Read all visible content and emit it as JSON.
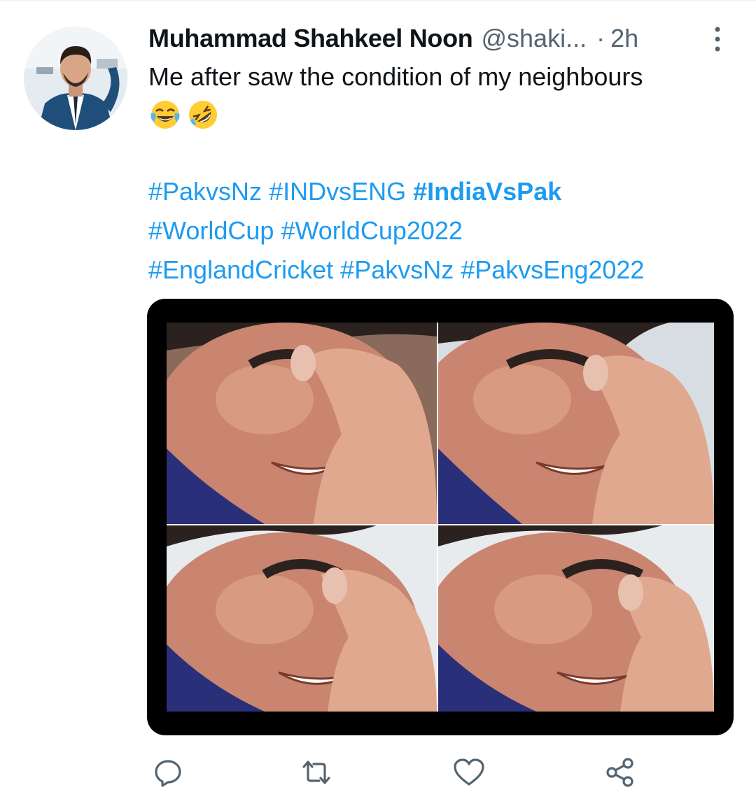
{
  "tweet": {
    "display_name": "Muhammad Shahkeel Noon",
    "handle": "@shaki...",
    "separator": "·",
    "timestamp": "2h",
    "text": "Me after saw the condition of my neighbours",
    "emojis": [
      "face-with-tears-of-joy",
      "rolling-on-floor-laughing"
    ],
    "hashtags_line1": [
      "#PakvsNz",
      "#INDvsENG",
      "#IndiaVsPak"
    ],
    "hashtags_line2": [
      "#WorldCup",
      "#WorldCup2022"
    ],
    "hashtags_line3": [
      "#EnglandCricket",
      "#PakvsNz",
      "#PakvsEng2022"
    ]
  },
  "media": {
    "description": "crying man meme grid",
    "panel_count": 4
  },
  "actions": {
    "icons": [
      "reply-icon",
      "retweet-icon",
      "like-icon",
      "share-icon"
    ]
  },
  "colors": {
    "link": "#1d9bf0",
    "text": "#0f1419",
    "secondary": "#536471",
    "icon": "#536471"
  }
}
